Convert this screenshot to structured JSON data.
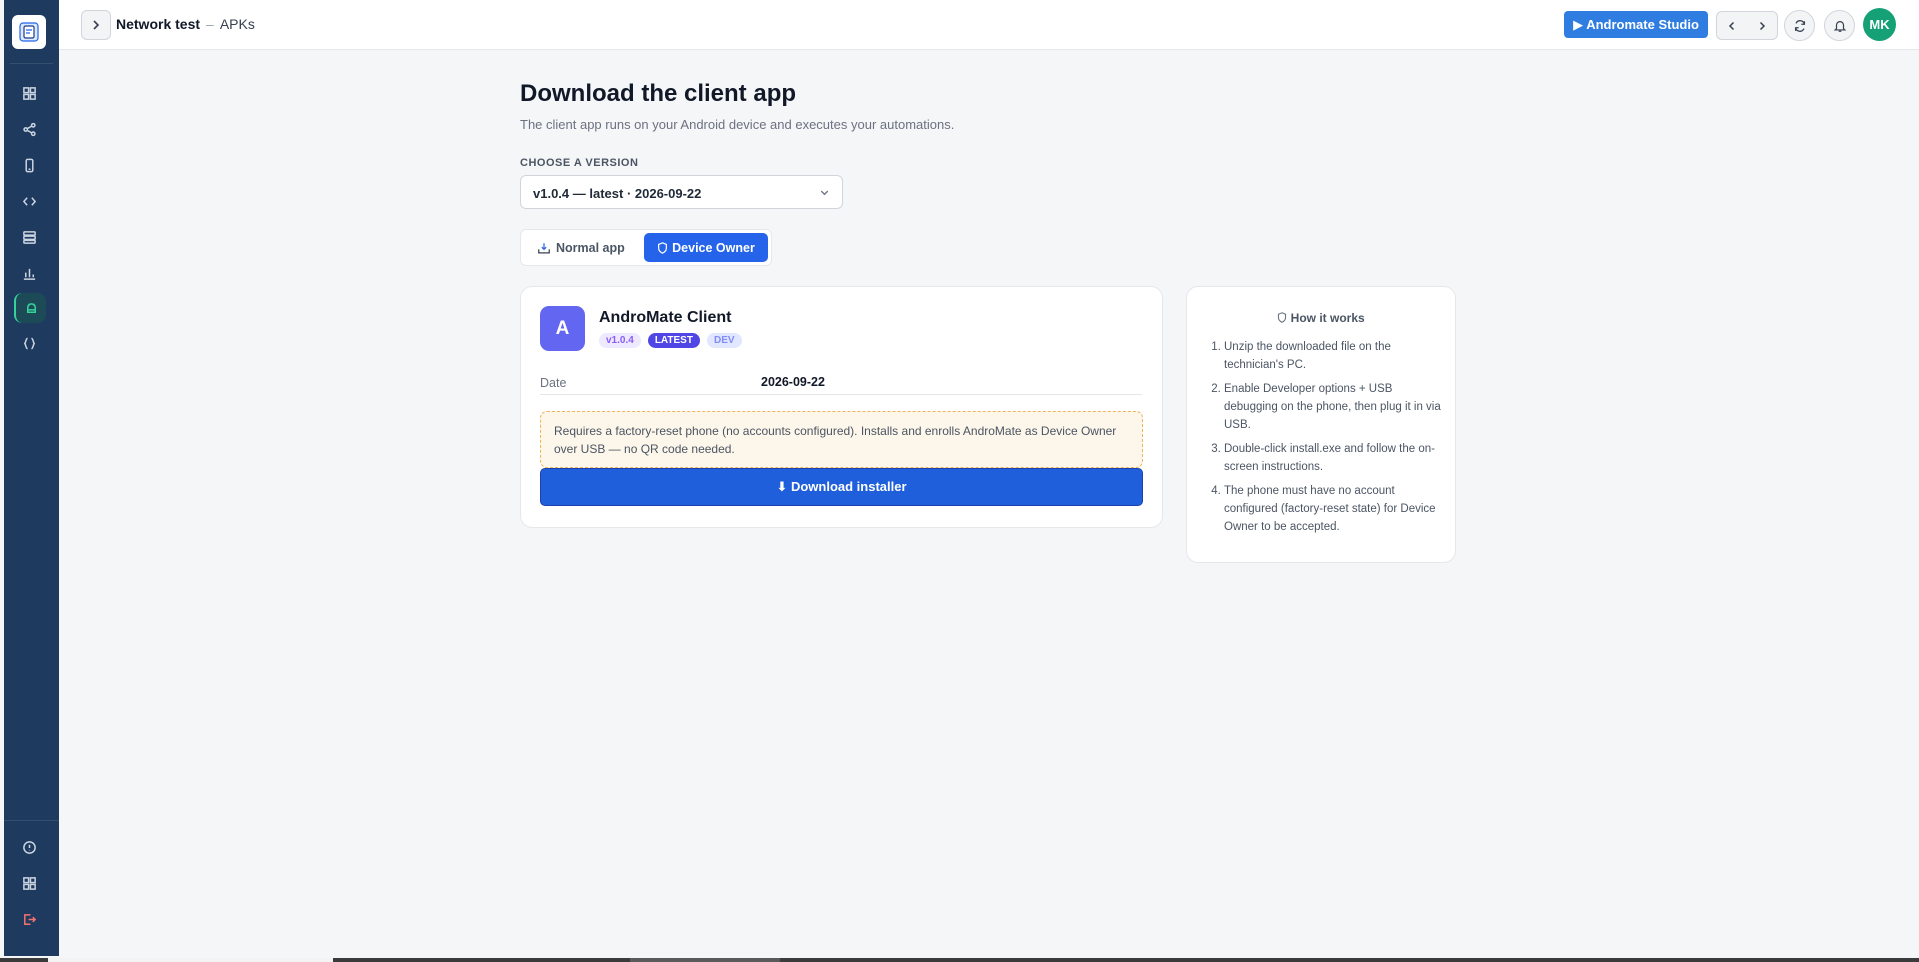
{
  "breadcrumb": {
    "project": "Network test",
    "separator": "–",
    "page": "APKs"
  },
  "topbar": {
    "studio_label": "▶ Andromate Studio",
    "avatar_initials": "MK"
  },
  "page": {
    "title": "Download the client app",
    "subtitle": "The client app runs on your Android device and executes your automations.",
    "version_label": "CHOOSE A VERSION",
    "version_selected": "v1.0.4 — latest · 2026-09-22"
  },
  "segment": {
    "normal_label": "Normal app",
    "owner_label": "Device Owner",
    "active": "owner"
  },
  "card": {
    "icon_letter": "A",
    "app_name": "AndroMate Client",
    "badge_version": "v1.0.4",
    "badge_latest": "LATEST",
    "badge_dev": "DEV",
    "date_label": "Date",
    "date_value": "2026-09-22",
    "warning": "Requires a factory-reset phone (no accounts configured). Installs and enrolls AndroMate as Device Owner over USB — no QR code needed.",
    "download_label": "⬇ Download installer"
  },
  "how": {
    "title": "How it works",
    "steps": [
      "Unzip the downloaded file on the technician's PC.",
      "Enable Developer options + USB debugging on the phone, then plug it in via USB.",
      "Double-click install.exe and follow the on-screen instructions.",
      "The phone must have no account configured (factory-reset state) for Device Owner to be accepted."
    ]
  },
  "colors": {
    "sidebar": "#1e3a5f",
    "accent": "#2563eb",
    "active_nav": "#34d399",
    "avatar": "#16a075"
  }
}
